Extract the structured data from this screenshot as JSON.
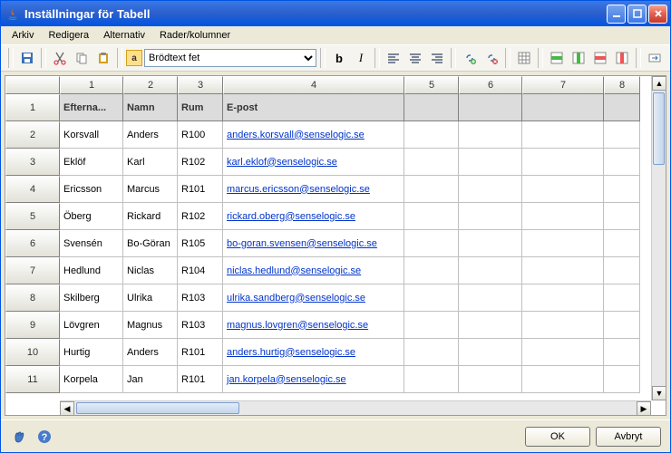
{
  "window": {
    "title": "Inställningar för Tabell"
  },
  "menu": {
    "arkiv": "Arkiv",
    "redigera": "Redigera",
    "alternativ": "Alternativ",
    "rader_kolumner": "Rader/kolumner"
  },
  "toolbar": {
    "format_icon_letter": "a",
    "format_value": "Brödtext fet"
  },
  "col_headers": [
    "1",
    "2",
    "3",
    "4",
    "5",
    "6",
    "7",
    "8"
  ],
  "row_numbers": [
    "1",
    "2",
    "3",
    "4",
    "5",
    "6",
    "7",
    "8",
    "9",
    "10",
    "11"
  ],
  "header_row": {
    "efternamn": "Efterna...",
    "namn": "Namn",
    "rum": "Rum",
    "epost": "E-post"
  },
  "rows": [
    {
      "efternamn": "Korsvall",
      "namn": "Anders",
      "rum": "R100",
      "epost": "anders.korsvall@senselogic.se"
    },
    {
      "efternamn": "Eklöf",
      "namn": "Karl",
      "rum": "R102",
      "epost": "karl.eklof@senselogic.se"
    },
    {
      "efternamn": "Ericsson",
      "namn": "Marcus",
      "rum": "R101",
      "epost": "marcus.ericsson@senselogic.se"
    },
    {
      "efternamn": "Öberg",
      "namn": "Rickard",
      "rum": "R102",
      "epost": "rickard.oberg@senselogic.se"
    },
    {
      "efternamn": "Svensén",
      "namn": "Bo-Göran",
      "rum": "R105",
      "epost": "bo-goran.svensen@senselogic.se"
    },
    {
      "efternamn": "Hedlund",
      "namn": "Niclas",
      "rum": "R104",
      "epost": "niclas.hedlund@senselogic.se"
    },
    {
      "efternamn": "Skilberg",
      "namn": "Ulrika",
      "rum": "R103",
      "epost": "ulrika.sandberg@senselogic.se"
    },
    {
      "efternamn": "Lövgren",
      "namn": "Magnus",
      "rum": "R103",
      "epost": "magnus.lovgren@senselogic.se"
    },
    {
      "efternamn": "Hurtig",
      "namn": "Anders",
      "rum": "R101",
      "epost": "anders.hurtig@senselogic.se"
    },
    {
      "efternamn": "Korpela",
      "namn": "Jan",
      "rum": "R101",
      "epost": "jan.korpela@senselogic.se"
    }
  ],
  "footer": {
    "ok": "OK",
    "avbryt": "Avbryt"
  }
}
